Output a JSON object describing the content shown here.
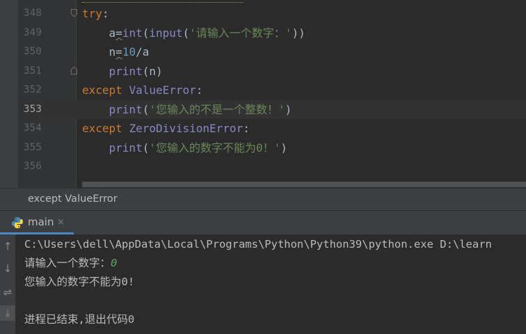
{
  "editor": {
    "lines": [
      {
        "num": "348",
        "tokens": [
          {
            "t": "try",
            "c": "kw"
          },
          {
            "t": ":",
            "c": ""
          }
        ]
      },
      {
        "num": "349",
        "tokens": [
          {
            "t": "    ",
            "c": ""
          },
          {
            "t": "a",
            "c": ""
          },
          {
            "t": "=",
            "c": "underline"
          },
          {
            "t": "int",
            "c": "bi"
          },
          {
            "t": "(",
            "c": ""
          },
          {
            "t": "input",
            "c": "bi"
          },
          {
            "t": "(",
            "c": ""
          },
          {
            "t": "'请输入一个数字：'",
            "c": "str"
          },
          {
            "t": "))",
            "c": ""
          }
        ]
      },
      {
        "num": "350",
        "tokens": [
          {
            "t": "    ",
            "c": ""
          },
          {
            "t": "n",
            "c": ""
          },
          {
            "t": "=",
            "c": "underline"
          },
          {
            "t": "10",
            "c": "num"
          },
          {
            "t": "/a",
            "c": ""
          }
        ]
      },
      {
        "num": "351",
        "tokens": [
          {
            "t": "    ",
            "c": ""
          },
          {
            "t": "print",
            "c": "bi"
          },
          {
            "t": "(n)",
            "c": ""
          }
        ]
      },
      {
        "num": "352",
        "tokens": [
          {
            "t": "except ",
            "c": "kw"
          },
          {
            "t": "ValueError",
            "c": "cls"
          },
          {
            "t": ":",
            "c": ""
          }
        ]
      },
      {
        "num": "353",
        "tokens": [
          {
            "t": "    ",
            "c": ""
          },
          {
            "t": "print",
            "c": "bi"
          },
          {
            "t": "(",
            "c": ""
          },
          {
            "t": "'您输入的不是一个整数！'",
            "c": "str"
          },
          {
            "t": ")",
            "c": ""
          }
        ]
      },
      {
        "num": "354",
        "tokens": [
          {
            "t": "except ",
            "c": "kw"
          },
          {
            "t": "ZeroDivisionError",
            "c": "cls"
          },
          {
            "t": ":",
            "c": ""
          }
        ]
      },
      {
        "num": "355",
        "tokens": [
          {
            "t": "    ",
            "c": ""
          },
          {
            "t": "print",
            "c": "bi"
          },
          {
            "t": "(",
            "c": ""
          },
          {
            "t": "'您输入的数字不能为0！'",
            "c": "str"
          },
          {
            "t": ")",
            "c": ""
          }
        ]
      },
      {
        "num": "356",
        "tokens": []
      }
    ],
    "current_line": "353"
  },
  "breadcrumb": {
    "text": "except ValueError"
  },
  "run": {
    "tab_label": "main",
    "close_glyph": "×"
  },
  "tools": {
    "up": "↑",
    "down": "↓",
    "wrap": "⇌",
    "scroll_end": "⤓"
  },
  "console": {
    "path_line": "C:\\Users\\dell\\AppData\\Local\\Programs\\Python\\Python39\\python.exe D:\\learn",
    "prompt": "请输入一个数字：",
    "user_input": "0",
    "error_output": "您输入的数字不能为0!",
    "exit_message": "进程已结束,退出代码0"
  },
  "colors": {
    "keyword": "#cc7832",
    "builtin": "#8888c6",
    "string": "#6a8759",
    "number": "#6897bb",
    "accent": "#4a88c7"
  }
}
